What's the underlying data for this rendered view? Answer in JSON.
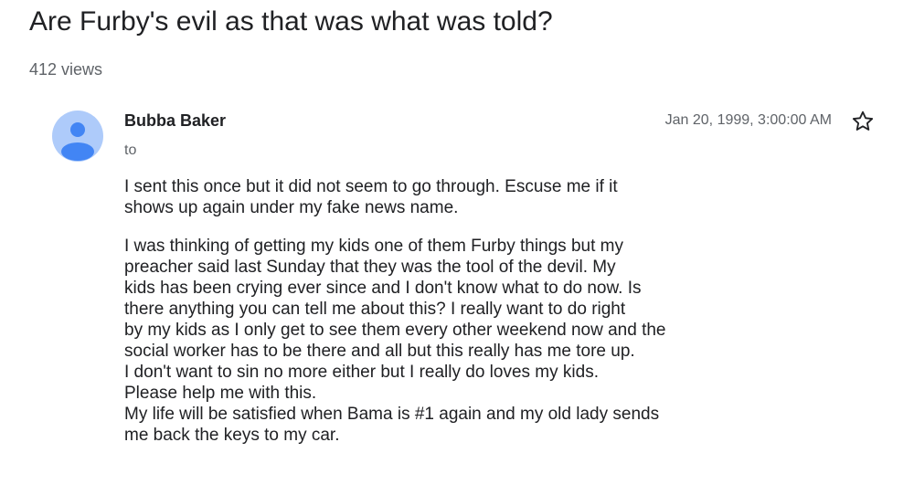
{
  "post": {
    "title": "Are Furby's evil as that was what was told?",
    "views": "412 views"
  },
  "message": {
    "author": "Bubba Baker",
    "to_label": "to",
    "date": "Jan 20, 1999, 3:00:00 AM",
    "avatar_icon": "person-avatar-icon",
    "star_icon": "star-outline-icon",
    "avatar_bg": "#aecbfa",
    "avatar_fg": "#4285f4",
    "paragraphs": [
      [
        "I sent this once but it did not seem to go through. Escuse me if it",
        "shows up again under my fake news name."
      ],
      [
        "I was thinking of getting my kids one of them Furby things but my",
        "preacher said last Sunday that they was the tool of the devil. My",
        "kids has been crying ever since and I don't know what to do now. Is",
        "there anything you can tell me about this? I really want to do right",
        "by my kids as I only get to see them every other weekend now and the",
        "social worker has to be there and all but this really has me tore up.",
        "I don't want to sin no more either but I really do loves my kids.",
        "Please help me with this.",
        "My life will be satisfied when Bama is #1 again and my old lady sends",
        "me back the keys to my car."
      ]
    ]
  }
}
